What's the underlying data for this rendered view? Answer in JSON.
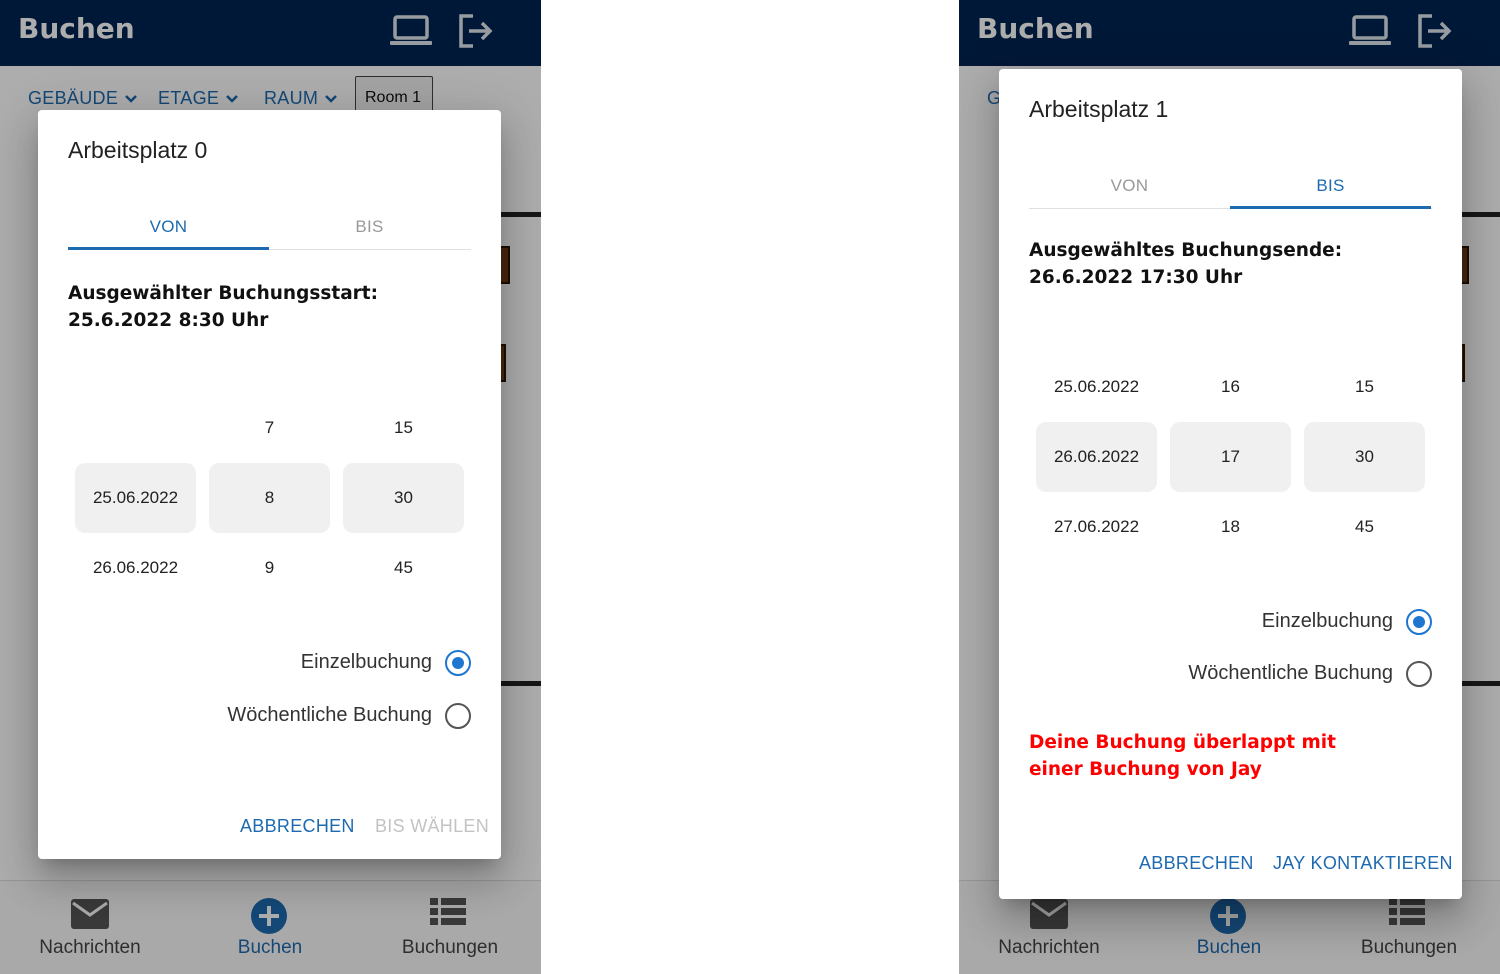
{
  "app": {
    "title": "Buchen"
  },
  "icons": {
    "laptop": "laptop-icon",
    "logout": "logout-icon",
    "messages": "mail-icon",
    "book": "add-circle-icon",
    "bookings": "list-icon"
  },
  "colors": {
    "appbar": "#002451",
    "accent": "#1e6ab0",
    "error": "#ff0000",
    "disabled": "#c3c3c3"
  },
  "filters": {
    "building": "GEBÄUDE",
    "floor": "ETAGE",
    "room": "RAUM",
    "room_value": "Room 1"
  },
  "nav": {
    "messages": "Nachrichten",
    "book": "Buchen",
    "bookings": "Buchungen"
  },
  "left": {
    "dialog_title": "Arbeitsplatz 0",
    "tab_from": "VON",
    "tab_to": "BIS",
    "selected_text": "Ausgewählter Buchungsstart: 25.6.2022 8:30 Uhr",
    "picker": {
      "dates": [
        "",
        "25.06.2022",
        "26.06.2022"
      ],
      "hours": [
        "7",
        "8",
        "9"
      ],
      "minutes": [
        "15",
        "30",
        "45"
      ],
      "selected": {
        "date": "25.06.2022",
        "hour": "8",
        "minute": "30"
      }
    },
    "radio_single": "Einzelbuchung",
    "radio_weekly": "Wöchentliche Buchung",
    "cancel": "ABBRECHEN",
    "confirm": "BIS WÄHLEN"
  },
  "right": {
    "dialog_title": "Arbeitsplatz 1",
    "tab_from": "VON",
    "tab_to": "BIS",
    "selected_text": "Ausgewähltes Buchungsende: 26.6.2022 17:30 Uhr",
    "picker": {
      "dates": [
        "25.06.2022",
        "26.06.2022",
        "27.06.2022"
      ],
      "hours": [
        "16",
        "17",
        "18"
      ],
      "minutes": [
        "15",
        "30",
        "45"
      ],
      "selected": {
        "date": "26.06.2022",
        "hour": "17",
        "minute": "30"
      }
    },
    "radio_single": "Einzelbuchung",
    "radio_weekly": "Wöchentliche Buchung",
    "error": "Deine Buchung überlappt mit einer Buchung von Jay",
    "cancel": "ABBRECHEN",
    "contact": "JAY KONTAKTIEREN"
  }
}
